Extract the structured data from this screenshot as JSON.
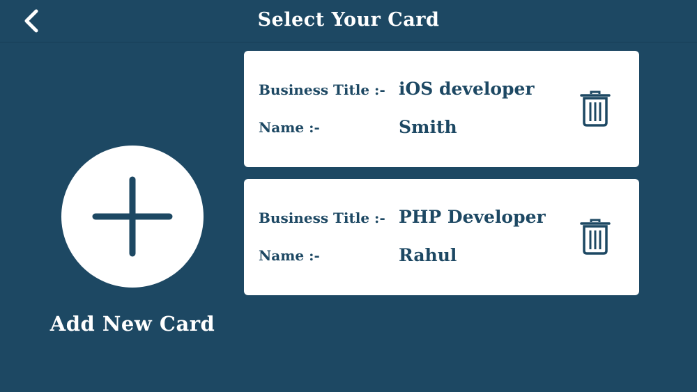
{
  "header": {
    "title": "Select Your Card",
    "back_icon": "chevron-left-icon"
  },
  "add_card": {
    "icon": "plus-icon",
    "label": "Add New Card"
  },
  "cards": [
    {
      "title_label": "Business Title :-",
      "title_value": "iOS developer",
      "name_label": "Name :-",
      "name_value": "Smith",
      "delete_icon": "trash-icon"
    },
    {
      "title_label": "Business Title :-",
      "title_value": "PHP Developer",
      "name_label": "Name :-",
      "name_value": "Rahul",
      "delete_icon": "trash-icon"
    }
  ],
  "colors": {
    "background": "#1d4863",
    "card": "#ffffff",
    "text_dark": "#1d4863",
    "text_light": "#ffffff"
  }
}
